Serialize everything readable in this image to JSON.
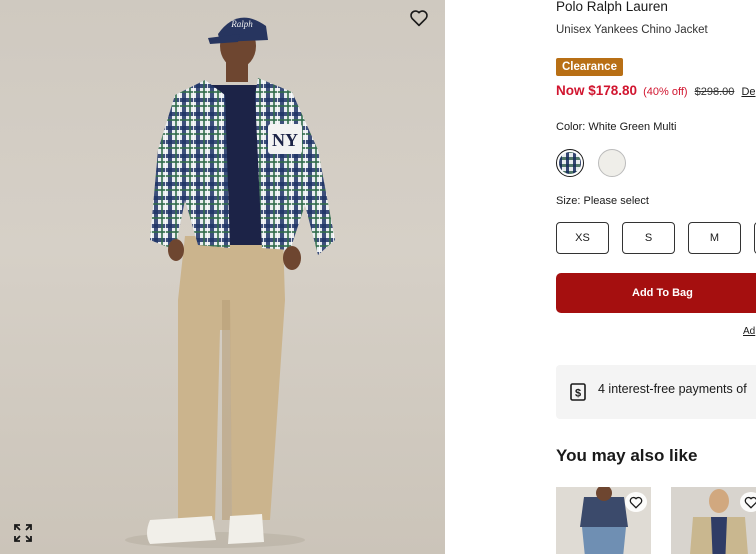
{
  "product": {
    "brand": "Polo Ralph Lauren",
    "name": "Unisex Yankees Chino Jacket",
    "badge": "Clearance",
    "price_now": "Now $178.80",
    "price_off": "(40% off)",
    "price_was": "$298.00",
    "price_link": "De",
    "color_label": "Color: White Green Multi",
    "size_label": "Size: Please select",
    "sizes": [
      "XS",
      "S",
      "M",
      ""
    ],
    "add_to_bag": "Add To Bag",
    "add_link": "Ad",
    "payments": "4 interest-free payments of",
    "you_may_also_like": "You may also like"
  },
  "icons": {
    "favorite": "heart-outline-icon",
    "expand": "expand-arrows-icon",
    "payment": "dollar-receipt-icon"
  },
  "colors": {
    "clearance": "#b86f15",
    "sale_price": "#d1152f",
    "add_to_bag": "#a50f0f",
    "pay_box": "#f4f4f4"
  }
}
